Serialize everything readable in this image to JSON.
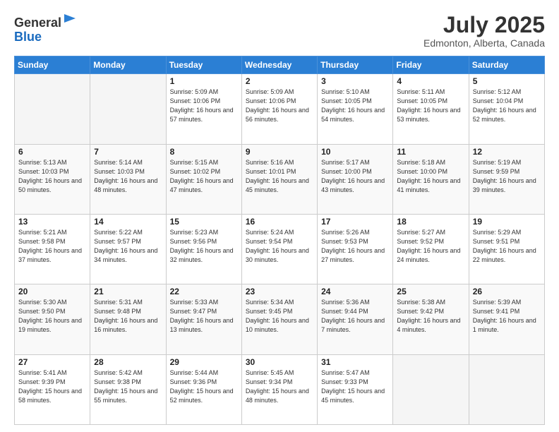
{
  "logo": {
    "line1": "General",
    "line2": "Blue"
  },
  "header": {
    "month": "July 2025",
    "location": "Edmonton, Alberta, Canada"
  },
  "weekdays": [
    "Sunday",
    "Monday",
    "Tuesday",
    "Wednesday",
    "Thursday",
    "Friday",
    "Saturday"
  ],
  "weeks": [
    [
      {
        "day": "",
        "sunrise": "",
        "sunset": "",
        "daylight": ""
      },
      {
        "day": "",
        "sunrise": "",
        "sunset": "",
        "daylight": ""
      },
      {
        "day": "1",
        "sunrise": "Sunrise: 5:09 AM",
        "sunset": "Sunset: 10:06 PM",
        "daylight": "Daylight: 16 hours and 57 minutes."
      },
      {
        "day": "2",
        "sunrise": "Sunrise: 5:09 AM",
        "sunset": "Sunset: 10:06 PM",
        "daylight": "Daylight: 16 hours and 56 minutes."
      },
      {
        "day": "3",
        "sunrise": "Sunrise: 5:10 AM",
        "sunset": "Sunset: 10:05 PM",
        "daylight": "Daylight: 16 hours and 54 minutes."
      },
      {
        "day": "4",
        "sunrise": "Sunrise: 5:11 AM",
        "sunset": "Sunset: 10:05 PM",
        "daylight": "Daylight: 16 hours and 53 minutes."
      },
      {
        "day": "5",
        "sunrise": "Sunrise: 5:12 AM",
        "sunset": "Sunset: 10:04 PM",
        "daylight": "Daylight: 16 hours and 52 minutes."
      }
    ],
    [
      {
        "day": "6",
        "sunrise": "Sunrise: 5:13 AM",
        "sunset": "Sunset: 10:03 PM",
        "daylight": "Daylight: 16 hours and 50 minutes."
      },
      {
        "day": "7",
        "sunrise": "Sunrise: 5:14 AM",
        "sunset": "Sunset: 10:03 PM",
        "daylight": "Daylight: 16 hours and 48 minutes."
      },
      {
        "day": "8",
        "sunrise": "Sunrise: 5:15 AM",
        "sunset": "Sunset: 10:02 PM",
        "daylight": "Daylight: 16 hours and 47 minutes."
      },
      {
        "day": "9",
        "sunrise": "Sunrise: 5:16 AM",
        "sunset": "Sunset: 10:01 PM",
        "daylight": "Daylight: 16 hours and 45 minutes."
      },
      {
        "day": "10",
        "sunrise": "Sunrise: 5:17 AM",
        "sunset": "Sunset: 10:00 PM",
        "daylight": "Daylight: 16 hours and 43 minutes."
      },
      {
        "day": "11",
        "sunrise": "Sunrise: 5:18 AM",
        "sunset": "Sunset: 10:00 PM",
        "daylight": "Daylight: 16 hours and 41 minutes."
      },
      {
        "day": "12",
        "sunrise": "Sunrise: 5:19 AM",
        "sunset": "Sunset: 9:59 PM",
        "daylight": "Daylight: 16 hours and 39 minutes."
      }
    ],
    [
      {
        "day": "13",
        "sunrise": "Sunrise: 5:21 AM",
        "sunset": "Sunset: 9:58 PM",
        "daylight": "Daylight: 16 hours and 37 minutes."
      },
      {
        "day": "14",
        "sunrise": "Sunrise: 5:22 AM",
        "sunset": "Sunset: 9:57 PM",
        "daylight": "Daylight: 16 hours and 34 minutes."
      },
      {
        "day": "15",
        "sunrise": "Sunrise: 5:23 AM",
        "sunset": "Sunset: 9:56 PM",
        "daylight": "Daylight: 16 hours and 32 minutes."
      },
      {
        "day": "16",
        "sunrise": "Sunrise: 5:24 AM",
        "sunset": "Sunset: 9:54 PM",
        "daylight": "Daylight: 16 hours and 30 minutes."
      },
      {
        "day": "17",
        "sunrise": "Sunrise: 5:26 AM",
        "sunset": "Sunset: 9:53 PM",
        "daylight": "Daylight: 16 hours and 27 minutes."
      },
      {
        "day": "18",
        "sunrise": "Sunrise: 5:27 AM",
        "sunset": "Sunset: 9:52 PM",
        "daylight": "Daylight: 16 hours and 24 minutes."
      },
      {
        "day": "19",
        "sunrise": "Sunrise: 5:29 AM",
        "sunset": "Sunset: 9:51 PM",
        "daylight": "Daylight: 16 hours and 22 minutes."
      }
    ],
    [
      {
        "day": "20",
        "sunrise": "Sunrise: 5:30 AM",
        "sunset": "Sunset: 9:50 PM",
        "daylight": "Daylight: 16 hours and 19 minutes."
      },
      {
        "day": "21",
        "sunrise": "Sunrise: 5:31 AM",
        "sunset": "Sunset: 9:48 PM",
        "daylight": "Daylight: 16 hours and 16 minutes."
      },
      {
        "day": "22",
        "sunrise": "Sunrise: 5:33 AM",
        "sunset": "Sunset: 9:47 PM",
        "daylight": "Daylight: 16 hours and 13 minutes."
      },
      {
        "day": "23",
        "sunrise": "Sunrise: 5:34 AM",
        "sunset": "Sunset: 9:45 PM",
        "daylight": "Daylight: 16 hours and 10 minutes."
      },
      {
        "day": "24",
        "sunrise": "Sunrise: 5:36 AM",
        "sunset": "Sunset: 9:44 PM",
        "daylight": "Daylight: 16 hours and 7 minutes."
      },
      {
        "day": "25",
        "sunrise": "Sunrise: 5:38 AM",
        "sunset": "Sunset: 9:42 PM",
        "daylight": "Daylight: 16 hours and 4 minutes."
      },
      {
        "day": "26",
        "sunrise": "Sunrise: 5:39 AM",
        "sunset": "Sunset: 9:41 PM",
        "daylight": "Daylight: 16 hours and 1 minute."
      }
    ],
    [
      {
        "day": "27",
        "sunrise": "Sunrise: 5:41 AM",
        "sunset": "Sunset: 9:39 PM",
        "daylight": "Daylight: 15 hours and 58 minutes."
      },
      {
        "day": "28",
        "sunrise": "Sunrise: 5:42 AM",
        "sunset": "Sunset: 9:38 PM",
        "daylight": "Daylight: 15 hours and 55 minutes."
      },
      {
        "day": "29",
        "sunrise": "Sunrise: 5:44 AM",
        "sunset": "Sunset: 9:36 PM",
        "daylight": "Daylight: 15 hours and 52 minutes."
      },
      {
        "day": "30",
        "sunrise": "Sunrise: 5:45 AM",
        "sunset": "Sunset: 9:34 PM",
        "daylight": "Daylight: 15 hours and 48 minutes."
      },
      {
        "day": "31",
        "sunrise": "Sunrise: 5:47 AM",
        "sunset": "Sunset: 9:33 PM",
        "daylight": "Daylight: 15 hours and 45 minutes."
      },
      {
        "day": "",
        "sunrise": "",
        "sunset": "",
        "daylight": ""
      },
      {
        "day": "",
        "sunrise": "",
        "sunset": "",
        "daylight": ""
      }
    ]
  ]
}
